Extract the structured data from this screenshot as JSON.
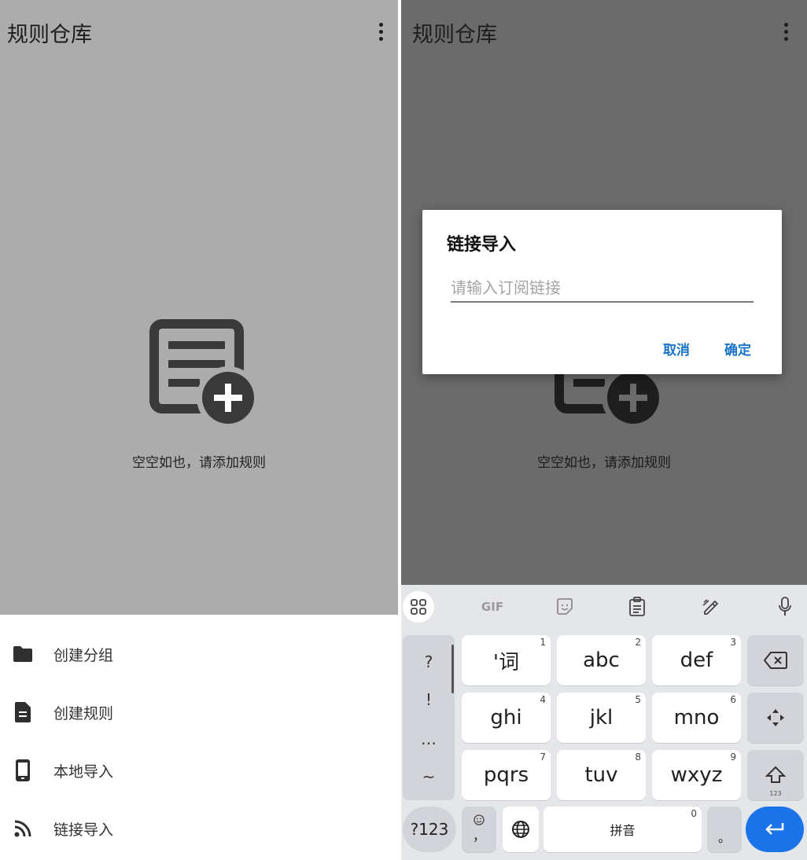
{
  "app": {
    "title": "规则仓库",
    "empty_state": "空空如也，请添加规则"
  },
  "sheet": {
    "items": [
      {
        "label": "创建分组",
        "icon": "folder-icon"
      },
      {
        "label": "创建规则",
        "icon": "document-icon"
      },
      {
        "label": "本地导入",
        "icon": "phone-icon"
      },
      {
        "label": "链接导入",
        "icon": "rss-icon"
      }
    ]
  },
  "dialog": {
    "title": "链接导入",
    "placeholder": "请输入订阅链接",
    "cancel": "取消",
    "confirm": "确定"
  },
  "keyboard": {
    "toolbar": [
      "apps-grid-icon",
      "GIF",
      "sticker-icon",
      "clipboard-icon",
      "handwriting-icon",
      "mic-icon"
    ],
    "gif_label": "GIF",
    "symbols": [
      "?",
      "!",
      "…",
      "~"
    ],
    "keys": [
      {
        "label": "'词",
        "num": "1"
      },
      {
        "label": "abc",
        "num": "2"
      },
      {
        "label": "def",
        "num": "3"
      },
      {
        "label": "ghi",
        "num": "4"
      },
      {
        "label": "jkl",
        "num": "5"
      },
      {
        "label": "mno",
        "num": "6"
      },
      {
        "label": "pqrs",
        "num": "7"
      },
      {
        "label": "tuv",
        "num": "8"
      },
      {
        "label": "wxyz",
        "num": "9"
      }
    ],
    "sym_key": "?123",
    "emoji_comma": "，",
    "space": "拼音",
    "space_num": "0",
    "period": "。",
    "shift_sub": "123"
  },
  "colors": {
    "left_scrim": "#acacac",
    "right_scrim": "#6b6b6b",
    "accent": "#1a73c8",
    "enter": "#1a73e8"
  }
}
